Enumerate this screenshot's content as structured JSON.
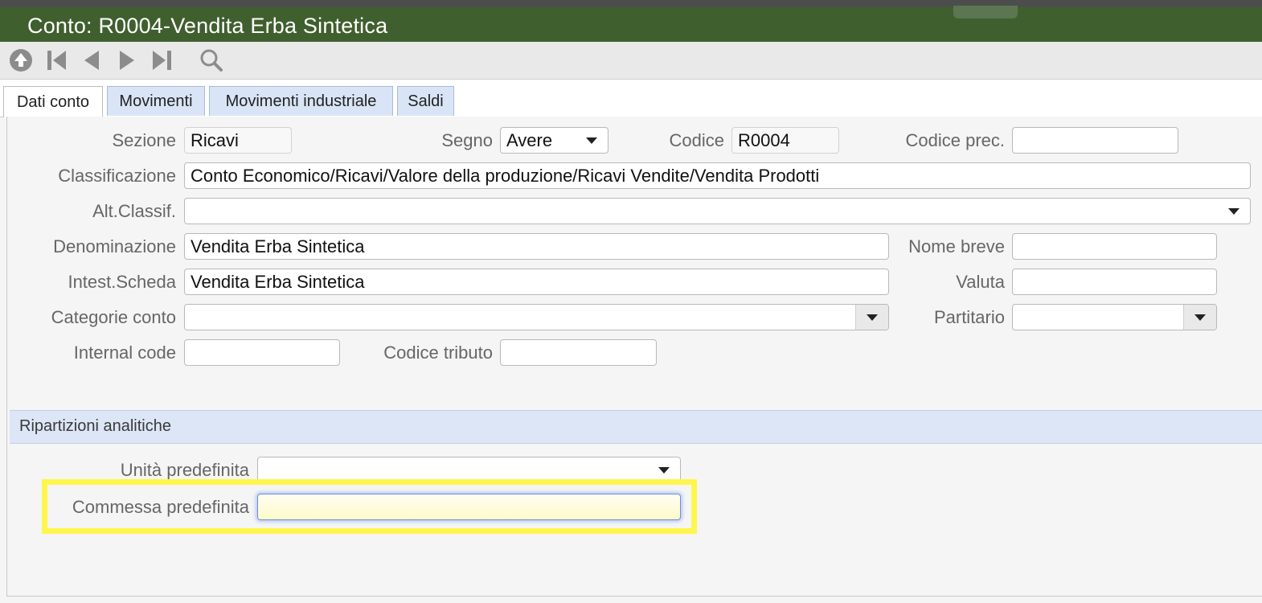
{
  "window": {
    "title": "Conto: R0004-Vendita Erba Sintetica"
  },
  "toolbar": {
    "buttons": [
      "up-icon",
      "first-record-icon",
      "previous-record-icon",
      "next-record-icon",
      "last-record-icon",
      "search-icon"
    ]
  },
  "tabs": [
    {
      "label": "Dati conto",
      "active": true
    },
    {
      "label": "Movimenti"
    },
    {
      "label": "Movimenti industriale"
    },
    {
      "label": "Saldi"
    }
  ],
  "form": {
    "sezione": {
      "label": "Sezione",
      "value": "Ricavi"
    },
    "segno": {
      "label": "Segno",
      "value": "Avere"
    },
    "codice": {
      "label": "Codice",
      "value": "R0004"
    },
    "codice_prec": {
      "label": "Codice prec.",
      "value": ""
    },
    "classificazione": {
      "label": "Classificazione",
      "value": "Conto Economico/Ricavi/Valore della produzione/Ricavi Vendite/Vendita Prodotti"
    },
    "alt_classif": {
      "label": "Alt.Classif.",
      "value": ""
    },
    "denominazione": {
      "label": "Denominazione",
      "value": "Vendita Erba Sintetica"
    },
    "nome_breve": {
      "label": "Nome breve",
      "value": ""
    },
    "intest_scheda": {
      "label": "Intest.Scheda",
      "value": "Vendita Erba Sintetica"
    },
    "valuta": {
      "label": "Valuta",
      "value": ""
    },
    "categorie_conto": {
      "label": "Categorie conto",
      "value": ""
    },
    "partitario": {
      "label": "Partitario",
      "value": ""
    },
    "internal_code": {
      "label": "Internal code",
      "value": ""
    },
    "codice_tributo": {
      "label": "Codice tributo",
      "value": ""
    }
  },
  "ripartizioni": {
    "title": "Ripartizioni analitiche",
    "unita_predefinita": {
      "label": "Unità predefinita",
      "value": ""
    },
    "commessa_predefinita": {
      "label": "Commessa predefinita",
      "value": ""
    }
  },
  "colors": {
    "title_bar": "#405f2e",
    "tab_inactive": "#d9e5f7",
    "section_header": "#dce6f6",
    "highlight": "#fff64d"
  }
}
